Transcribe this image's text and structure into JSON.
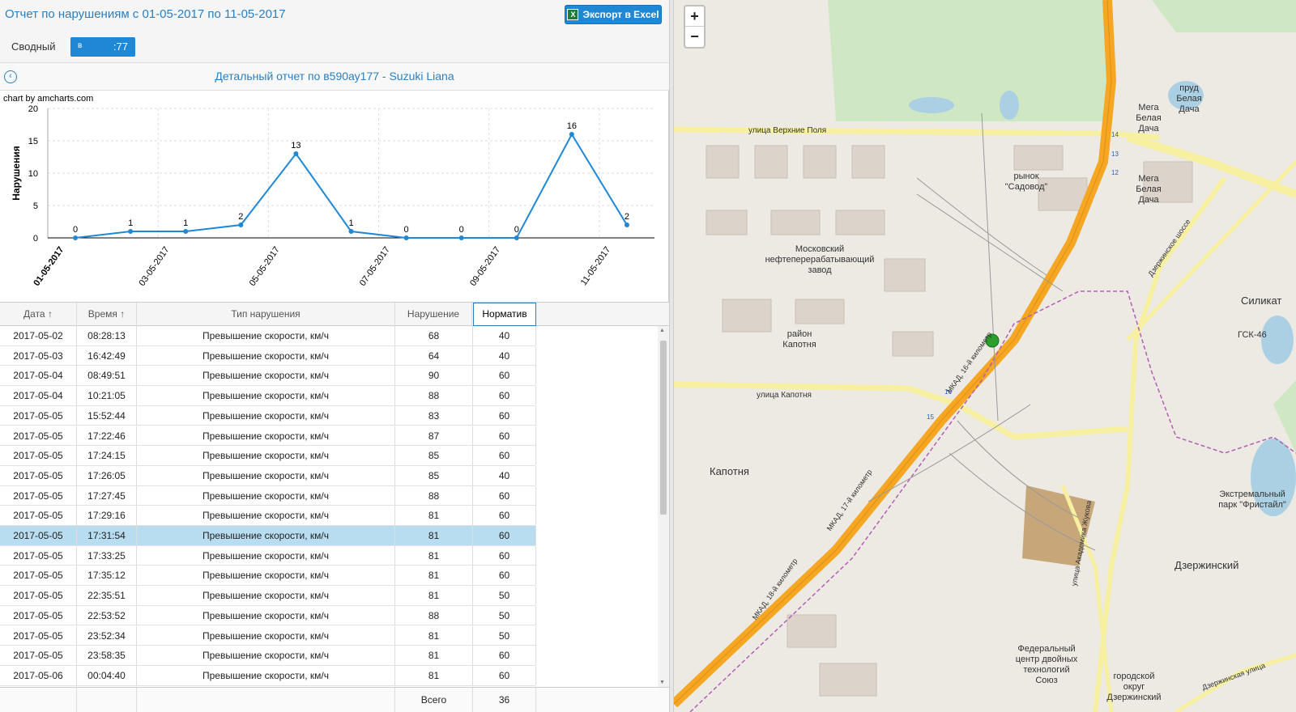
{
  "header": {
    "title": "Отчет по нарушениям с 01-05-2017 по 11-05-2017",
    "export_label": "Экспорт в Excel",
    "export_icon": "excel-icon"
  },
  "tabs": {
    "summary_label": "Сводный",
    "vehicle_left": "в",
    "vehicle_right": ":77"
  },
  "detail": {
    "title": "Детальный отчет по в590ау177 - Suzuki Liana",
    "back_icon": "back-arrow-icon"
  },
  "chart_credit": "chart by amcharts.com",
  "chart_data": {
    "type": "line",
    "ylabel": "Нарушения",
    "ylim": [
      0,
      20
    ],
    "yticks": [
      "0",
      "5",
      "10",
      "15",
      "20"
    ],
    "x": [
      "01-05-2017",
      "02-05-2017",
      "03-05-2017",
      "04-05-2017",
      "05-05-2017",
      "06-05-2017",
      "07-05-2017",
      "08-05-2017",
      "09-05-2017",
      "10-05-2017",
      "11-05-2017"
    ],
    "xtick_labels": [
      "01-05-2017",
      "03-05-2017",
      "05-05-2017",
      "07-05-2017",
      "09-05-2017",
      "11-05-2017"
    ],
    "values": [
      0,
      1,
      1,
      2,
      13,
      1,
      0,
      0,
      0,
      16,
      2
    ],
    "color": "#1e88d6",
    "grid": true
  },
  "table": {
    "headers": {
      "date": "Дата",
      "time": "Время",
      "type": "Тип нарушения",
      "violation": "Нарушение",
      "norm": "Норматив"
    },
    "rows": [
      {
        "date": "2017-05-02",
        "time": "08:28:13",
        "type": "Превышение скорости, км/ч",
        "violation": "68",
        "norm": "40"
      },
      {
        "date": "2017-05-03",
        "time": "16:42:49",
        "type": "Превышение скорости, км/ч",
        "violation": "64",
        "norm": "40"
      },
      {
        "date": "2017-05-04",
        "time": "08:49:51",
        "type": "Превышение скорости, км/ч",
        "violation": "90",
        "norm": "60"
      },
      {
        "date": "2017-05-04",
        "time": "10:21:05",
        "type": "Превышение скорости, км/ч",
        "violation": "88",
        "norm": "60"
      },
      {
        "date": "2017-05-05",
        "time": "15:52:44",
        "type": "Превышение скорости, км/ч",
        "violation": "83",
        "norm": "60"
      },
      {
        "date": "2017-05-05",
        "time": "17:22:46",
        "type": "Превышение скорости, км/ч",
        "violation": "87",
        "norm": "60"
      },
      {
        "date": "2017-05-05",
        "time": "17:24:15",
        "type": "Превышение скорости, км/ч",
        "violation": "85",
        "norm": "60"
      },
      {
        "date": "2017-05-05",
        "time": "17:26:05",
        "type": "Превышение скорости, км/ч",
        "violation": "85",
        "norm": "40"
      },
      {
        "date": "2017-05-05",
        "time": "17:27:45",
        "type": "Превышение скорости, км/ч",
        "violation": "88",
        "norm": "60"
      },
      {
        "date": "2017-05-05",
        "time": "17:29:16",
        "type": "Превышение скорости, км/ч",
        "violation": "81",
        "norm": "60"
      },
      {
        "date": "2017-05-05",
        "time": "17:31:54",
        "type": "Превышение скорости, км/ч",
        "violation": "81",
        "norm": "60",
        "selected": true
      },
      {
        "date": "2017-05-05",
        "time": "17:33:25",
        "type": "Превышение скорости, км/ч",
        "violation": "81",
        "norm": "60"
      },
      {
        "date": "2017-05-05",
        "time": "17:35:12",
        "type": "Превышение скорости, км/ч",
        "violation": "81",
        "norm": "60"
      },
      {
        "date": "2017-05-05",
        "time": "22:35:51",
        "type": "Превышение скорости, км/ч",
        "violation": "81",
        "norm": "50"
      },
      {
        "date": "2017-05-05",
        "time": "22:53:52",
        "type": "Превышение скорости, км/ч",
        "violation": "88",
        "norm": "50"
      },
      {
        "date": "2017-05-05",
        "time": "23:52:34",
        "type": "Превышение скорости, км/ч",
        "violation": "81",
        "norm": "50"
      },
      {
        "date": "2017-05-05",
        "time": "23:58:35",
        "type": "Превышение скорости, км/ч",
        "violation": "81",
        "norm": "60"
      },
      {
        "date": "2017-05-06",
        "time": "00:04:40",
        "type": "Превышение скорости, км/ч",
        "violation": "81",
        "norm": "60"
      }
    ],
    "footer": {
      "label": "Всего",
      "value": "36"
    }
  },
  "map": {
    "zoom_in": "+",
    "zoom_out": "−",
    "labels": {
      "street_verkhnie_polya": "улица Верхние Поля",
      "market": "рынок \"Садовод\"",
      "refinery": "Московский нефтеперерабатывающий завод",
      "district_kapotnya": "район Капотня",
      "street_kapotnya": "улица Капотня",
      "kapotnya": "Капотня",
      "pond": "пруд Белая Дача",
      "mega1": "Мега Белая Дача",
      "mega2": "Мега Белая Дача",
      "silikat": "Силикат",
      "gsk": "ГСК-46",
      "dzerzhinsky": "Дзержинский",
      "fristail": "Экстремальный парк \"Фристайл\"",
      "federal_center": "Федеральный центр двойных технологий Союз",
      "city_district": "городской округ Дзержинский",
      "mkad16": "МКАД, 16-й километр",
      "mkad17": "МКАД, 17-й километр",
      "mkad18": "МКАД, 18-й километр",
      "dzerzhinskoe_shosse": "Дзержинское шоссе",
      "zhukova": "улица Академика Жукова",
      "dzerzhinskaya": "Дзержинская улица",
      "km16": "16",
      "km15": "15",
      "km14": "14",
      "km13": "13",
      "km12": "12"
    },
    "marker_color": "#2aa02a",
    "mkad_color": "#f5a623"
  }
}
